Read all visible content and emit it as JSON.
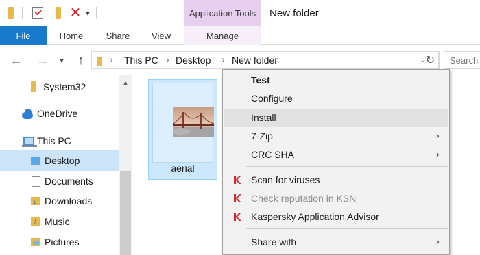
{
  "titlebar": {
    "app_tools_label": "Application Tools",
    "window_title": "New folder",
    "qa_icons": [
      "folder-icon",
      "properties-checkmark-icon",
      "new-folder-icon",
      "delete-x-icon",
      "dropdown-arrow-icon"
    ]
  },
  "tabs": {
    "file": "File",
    "home": "Home",
    "share": "Share",
    "view": "View",
    "manage": "Manage"
  },
  "address": {
    "crumbs": [
      "This PC",
      "Desktop",
      "New folder"
    ],
    "search_placeholder": "Search"
  },
  "navpane": {
    "items": [
      {
        "label": "System32",
        "icon": "folder-icon"
      },
      {
        "label": "OneDrive",
        "icon": "cloud-icon"
      },
      {
        "label": "This PC",
        "icon": "computer-icon"
      },
      {
        "label": "Desktop",
        "icon": "folder-icon",
        "selected": true
      },
      {
        "label": "Documents",
        "icon": "documents-icon"
      },
      {
        "label": "Downloads",
        "icon": "downloads-icon"
      },
      {
        "label": "Music",
        "icon": "music-icon"
      },
      {
        "label": "Pictures",
        "icon": "pictures-icon"
      }
    ]
  },
  "content": {
    "files": [
      {
        "name": "aerial",
        "selected": true
      }
    ]
  },
  "context_menu": {
    "items": [
      {
        "label": "Test",
        "bold": true
      },
      {
        "label": "Configure"
      },
      {
        "label": "Install",
        "highlighted": true
      },
      {
        "label": "7-Zip",
        "submenu": true
      },
      {
        "label": "CRC SHA",
        "submenu": true
      },
      {
        "label": "Scan for viruses",
        "icon": "kaspersky-icon"
      },
      {
        "label": "Check reputation in KSN",
        "icon": "kaspersky-icon",
        "disabled": true
      },
      {
        "label": "Kaspersky Application Advisor",
        "icon": "kaspersky-icon"
      },
      {
        "label": "Share with",
        "submenu": true
      }
    ]
  },
  "colors": {
    "accent_blue": "#1979ca",
    "app_tools_purple": "#e7cfef",
    "selection_blue": "#cce4f7",
    "kaspersky_red": "#d42a2a"
  }
}
